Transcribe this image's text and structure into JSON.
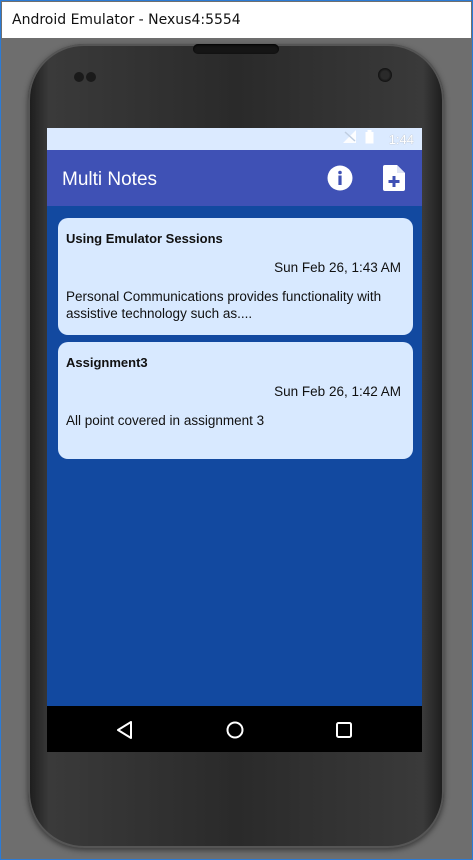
{
  "window": {
    "title": "Android Emulator - Nexus4:5554"
  },
  "status_bar": {
    "time": "1:44",
    "icons": [
      "signal-icon",
      "battery-icon"
    ]
  },
  "app_bar": {
    "title": "Multi Notes",
    "actions": [
      {
        "name": "info-icon"
      },
      {
        "name": "add-note-icon"
      }
    ]
  },
  "notes": [
    {
      "title": "Using Emulator Sessions",
      "date": "Sun Feb 26, 1:43 AM",
      "body": "Personal Communications provides functionality with assistive technology such as...."
    },
    {
      "title": "Assignment3",
      "date": "Sun Feb 26, 1:42 AM",
      "body": "All point covered in assignment 3"
    }
  ],
  "nav_bar": {
    "buttons": [
      "back-icon",
      "home-icon",
      "recents-icon"
    ]
  },
  "colors": {
    "app_bar": "#3f51b5",
    "background": "#1249a0",
    "card": "#d8e9ff",
    "status_bar": "#dbeaff"
  }
}
